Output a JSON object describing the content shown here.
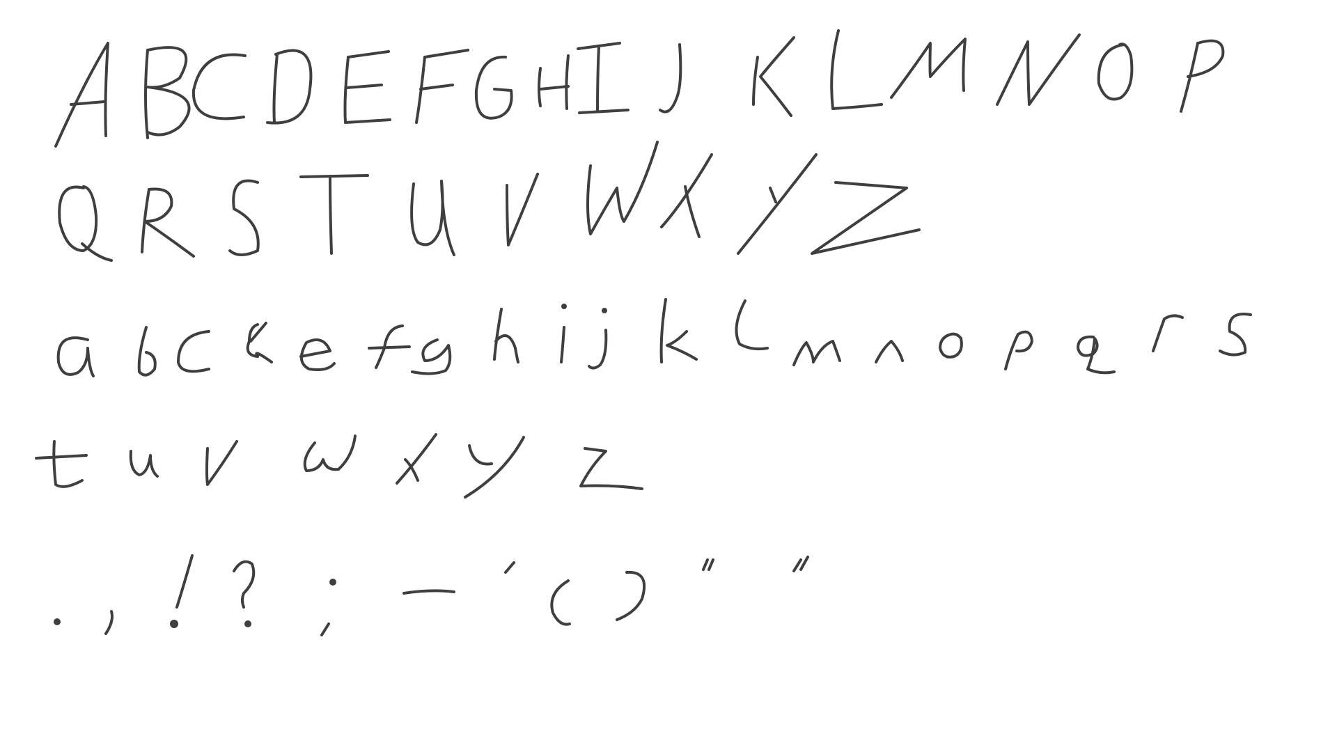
{
  "canvas": {
    "background": "#ffffff",
    "ink_color": "#3f3f3f"
  },
  "rows": [
    {
      "name": "uppercase-a-to-p",
      "chars": [
        "A",
        "B",
        "C",
        "D",
        "E",
        "F",
        "G",
        "H",
        "I",
        "J",
        "K",
        "L",
        "M",
        "N",
        "O",
        "P"
      ]
    },
    {
      "name": "uppercase-q-to-z",
      "chars": [
        "Q",
        "R",
        "S",
        "T",
        "U",
        "V",
        "W",
        "X",
        "Y",
        "Z"
      ]
    },
    {
      "name": "lowercase-a-to-s",
      "chars": [
        "a",
        "b",
        "c",
        "d",
        "e",
        "f",
        "g",
        "h",
        "i",
        "j",
        "k",
        "l",
        "m",
        "n",
        "o",
        "p",
        "q",
        "r",
        "s"
      ]
    },
    {
      "name": "lowercase-t-to-z",
      "chars": [
        "t",
        "u",
        "v",
        "w",
        "x",
        "y",
        "z"
      ]
    },
    {
      "name": "punctuation",
      "chars": [
        ".",
        ",",
        "!",
        "?",
        ";",
        "-",
        "'",
        "(",
        ")",
        "“",
        "”"
      ]
    }
  ]
}
